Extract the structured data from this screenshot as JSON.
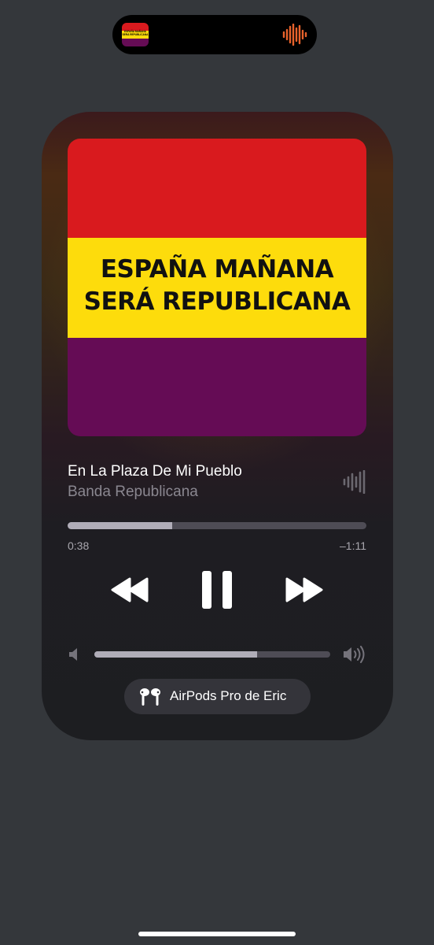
{
  "island": {
    "art_line1": "ESPAÑA MAÑANA",
    "art_line2": "SERÁ REPUBLICANA",
    "wave_icon": "waveform-icon",
    "wave_color": "#e8622c"
  },
  "player": {
    "artwork": {
      "line1": "ESPAÑA MAÑANA",
      "line2": "SERÁ REPUBLICANA",
      "colors": {
        "red": "#d91a1e",
        "yellow": "#fddc0c",
        "purple": "#650c55"
      }
    },
    "song_title": "En La Plaza De Mi Pueblo",
    "artist": "Banda Republicana",
    "elapsed": "0:38",
    "remaining": "–1:11",
    "progress_fraction": 0.35,
    "volume_fraction": 0.69,
    "controls": {
      "rewind_icon": "rewind-icon",
      "pause_icon": "pause-icon",
      "forward_icon": "fast-forward-icon"
    },
    "output_device": "AirPods Pro de Eric"
  }
}
